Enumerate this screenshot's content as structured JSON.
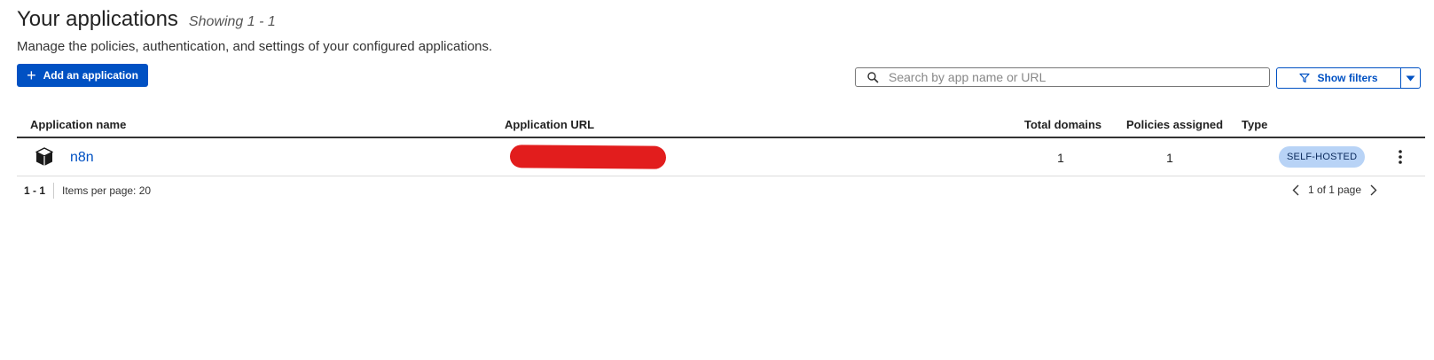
{
  "header": {
    "title": "Your applications",
    "showing": "Showing 1 - 1",
    "subtitle": "Manage the policies, authentication, and settings of your configured applications."
  },
  "toolbar": {
    "add_label": "Add an application",
    "search_placeholder": "Search by app name or URL",
    "filters_label": "Show filters"
  },
  "table": {
    "columns": [
      "Application name",
      "Application URL",
      "Total domains",
      "Policies assigned",
      "Type"
    ],
    "rows": [
      {
        "name": "n8n",
        "total_domains": "1",
        "policies_assigned": "1",
        "type": "SELF-HOSTED"
      }
    ]
  },
  "pagination": {
    "range": "1 - 1",
    "items_per_page": "Items per page: 20",
    "page_info": "1 of 1 page"
  },
  "colors": {
    "primary": "#0051c3",
    "badge_bg": "#b8d3f6",
    "redaction": "#e21d1d"
  }
}
